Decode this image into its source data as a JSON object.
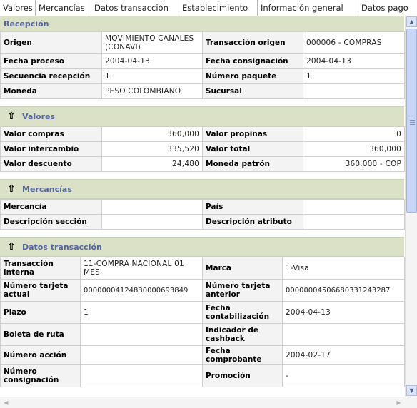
{
  "tabs": [
    "Valores",
    "Mercancías",
    "Datos transacción",
    "Establecimiento",
    "Información general",
    "Datos pago"
  ],
  "recepcion": {
    "title": "Recepción",
    "rows": [
      [
        "Origen",
        "MOVIMIENTO CANALES (CONAVI)",
        "Transacción origen",
        "000006 - COMPRAS"
      ],
      [
        "Fecha proceso",
        "2004-04-13",
        "Fecha consignación",
        "2004-04-13"
      ],
      [
        "Secuencia recepción",
        "1",
        "Número paquete",
        "1"
      ],
      [
        "Moneda",
        "PESO COLOMBIANO",
        "Sucursal",
        ""
      ]
    ]
  },
  "valores": {
    "title": "Valores",
    "rows": [
      [
        "Valor compras",
        "360,000",
        "Valor propinas",
        "0"
      ],
      [
        "Valor intercambio",
        "335,520",
        "Valor total",
        "360,000"
      ],
      [
        "Valor descuento",
        "24,480",
        "Moneda patrón",
        "360,000 - COP"
      ]
    ]
  },
  "mercancias": {
    "title": "Mercancías",
    "rows": [
      [
        "Mercancía",
        "",
        "País",
        ""
      ],
      [
        "Descripción sección",
        "",
        "Descripción atributo",
        ""
      ]
    ]
  },
  "datos_transaccion": {
    "title": "Datos transacción",
    "rows": [
      [
        "Transacción interna",
        "11-COMPRA NACIONAL 01 MES",
        "Marca",
        "1-Visa"
      ],
      [
        "Número tarjeta actual",
        "0000000412483000069384​9",
        "Número tarjeta anterior",
        "0000000450668033124328​7"
      ],
      [
        "Plazo",
        "1",
        "Fecha contabilización",
        "2004-04-13"
      ],
      [
        "Boleta de ruta",
        "",
        "Indicador de cashback",
        ""
      ],
      [
        "Número acción",
        "",
        "Fecha comprobante",
        "2004-02-17"
      ],
      [
        "Número consignación",
        "",
        "Promoción",
        "-"
      ]
    ]
  }
}
